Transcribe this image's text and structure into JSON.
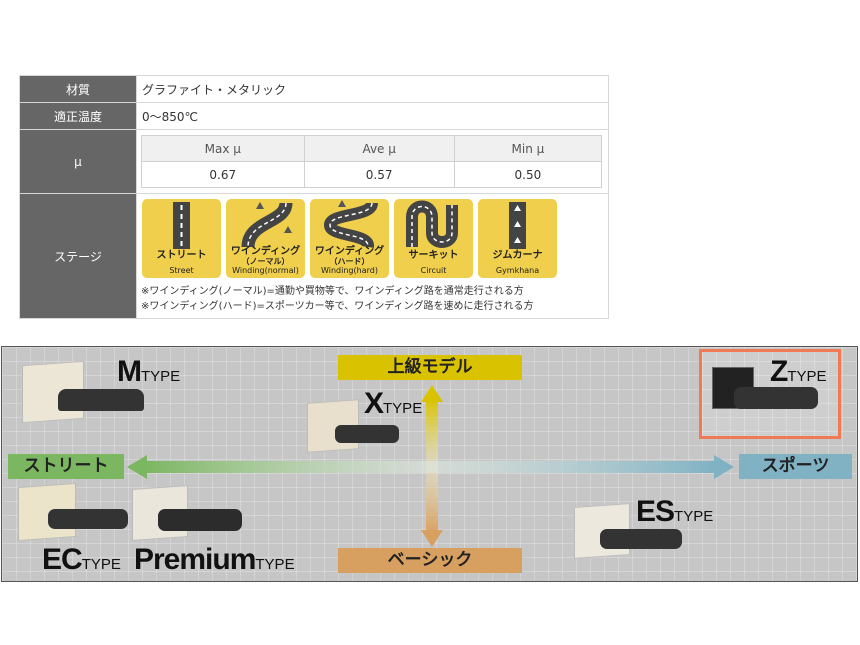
{
  "spec": {
    "material_label": "材質",
    "material_value": "グラファイト・メタリック",
    "temp_label": "適正温度",
    "temp_value": "0～850℃",
    "mu_label": "μ",
    "mu_headers": [
      "Max μ",
      "Ave μ",
      "Min μ"
    ],
    "mu_values": [
      "0.67",
      "0.57",
      "0.50"
    ],
    "stage_label": "ステージ",
    "stages": [
      {
        "jp": "ストリート",
        "en": "Street"
      },
      {
        "jp1": "ワインディング",
        "jp2": "（ノーマル）",
        "en": "Winding(normal)"
      },
      {
        "jp1": "ワインディング",
        "jp2": "（ハード）",
        "en": "Winding(hard)"
      },
      {
        "jp": "サーキット",
        "en": "Circuit"
      },
      {
        "jp": "ジムカーナ",
        "en": "Gymkhana"
      }
    ],
    "notes": [
      "※ワインディング(ノーマル)=通勤や買物等で、ワインディング路を通常走行される方",
      "※ワインディング(ハード)=スポーツカー等で、ワインディング路を速めに走行される方"
    ]
  },
  "map": {
    "top_label": "上級モデル",
    "bottom_label": "ベーシック",
    "left_label": "ストリート",
    "right_label": "スポーツ",
    "types": {
      "m": {
        "letter": "M",
        "suffix": "TYPE"
      },
      "x": {
        "letter": "X",
        "suffix": "TYPE"
      },
      "z": {
        "letter": "Z",
        "suffix": "TYPE"
      },
      "ec": {
        "letter": "EC",
        "suffix": "TYPE"
      },
      "premium": {
        "letter": "Premium",
        "suffix": "TYPE"
      },
      "es": {
        "letter": "ES",
        "suffix": "TYPE"
      }
    },
    "colors": {
      "yellow": "#d9c300",
      "orange": "#d8a060",
      "green": "#7bb661",
      "blue": "#80b2c4",
      "highlight": "#f07a56"
    }
  }
}
